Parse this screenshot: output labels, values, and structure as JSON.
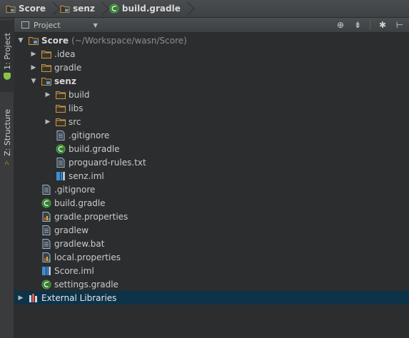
{
  "breadcrumbs": [
    {
      "label": "Score",
      "icon": "module-folder-icon"
    },
    {
      "label": "senz",
      "icon": "module-folder-icon"
    },
    {
      "label": "build.gradle",
      "icon": "gradle-icon"
    }
  ],
  "tool_strip": {
    "project_tab": "1: Project",
    "structure_tab": "Z: Structure"
  },
  "project_header": {
    "view_selector": "Project",
    "icons": [
      "locate-icon",
      "collapse-all-icon",
      "settings-gear-icon",
      "hide-panel-icon"
    ]
  },
  "tree": {
    "root_name": "Score",
    "root_path": "(~/Workspace/wasn/Score)",
    "items": [
      {
        "label": ".idea",
        "icon": "folder-icon",
        "arrow": "right"
      },
      {
        "label": "gradle",
        "icon": "folder-icon",
        "arrow": "right"
      },
      {
        "label": "senz",
        "icon": "module-folder-icon",
        "arrow": "down"
      },
      {
        "label": "build",
        "icon": "folder-icon",
        "arrow": "right"
      },
      {
        "label": "libs",
        "icon": "folder-icon",
        "arrow": ""
      },
      {
        "label": "src",
        "icon": "folder-icon",
        "arrow": "right"
      },
      {
        "label": ".gitignore",
        "icon": "text-file-icon",
        "arrow": ""
      },
      {
        "label": "build.gradle",
        "icon": "gradle-icon",
        "arrow": ""
      },
      {
        "label": "proguard-rules.txt",
        "icon": "text-file-icon",
        "arrow": ""
      },
      {
        "label": "senz.iml",
        "icon": "iml-file-icon",
        "arrow": ""
      },
      {
        "label": ".gitignore",
        "icon": "text-file-icon",
        "arrow": ""
      },
      {
        "label": "build.gradle",
        "icon": "gradle-icon",
        "arrow": ""
      },
      {
        "label": "gradle.properties",
        "icon": "properties-file-icon",
        "arrow": ""
      },
      {
        "label": "gradlew",
        "icon": "text-file-icon",
        "arrow": ""
      },
      {
        "label": "gradlew.bat",
        "icon": "text-file-icon",
        "arrow": ""
      },
      {
        "label": "local.properties",
        "icon": "properties-file-icon",
        "arrow": ""
      },
      {
        "label": "Score.iml",
        "icon": "iml-file-icon",
        "arrow": ""
      },
      {
        "label": "settings.gradle",
        "icon": "gradle-icon",
        "arrow": ""
      },
      {
        "label": "External Libraries",
        "icon": "libraries-icon",
        "arrow": "right"
      }
    ]
  },
  "colors": {
    "background": "#2b2d2e",
    "selection": "#0d3349",
    "folder": "#c39a52",
    "gradle": "#4fa84d",
    "iml": "#3d8ed6"
  }
}
